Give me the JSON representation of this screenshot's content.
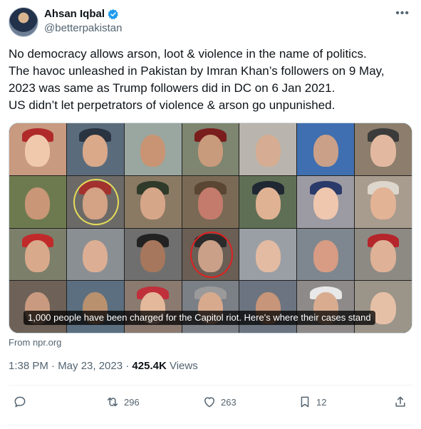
{
  "author": {
    "name": "Ahsan Iqbal",
    "handle": "@betterpakistan"
  },
  "tweet": {
    "lines": [
      "No democracy allows arson, loot & violence in the name of politics.",
      "The havoc unleashed in Pakistan by Imran Khan’s followers on 9 May,",
      "2023 was same as Trump followers did in DC on 6 Jan 2021.",
      "US didn’t let perpetrators of violence & arson go unpunished."
    ]
  },
  "card": {
    "caption": "1,000 people have been charged for the Capitol riot. Here's where their cases stand",
    "source": "From npr.org"
  },
  "meta": {
    "time_date": "1:38 PM · May 23, 2023 · ",
    "views_count": "425.4K",
    "views_label": " Views"
  },
  "actions": {
    "reply_icon": "reply-icon",
    "retweet_count": "296",
    "like_count": "263",
    "bookmark_count": "12",
    "share_icon": "share-icon"
  },
  "colors": {
    "accent": "#1d9bf0",
    "text": "#0f1419",
    "muted": "#536471"
  }
}
